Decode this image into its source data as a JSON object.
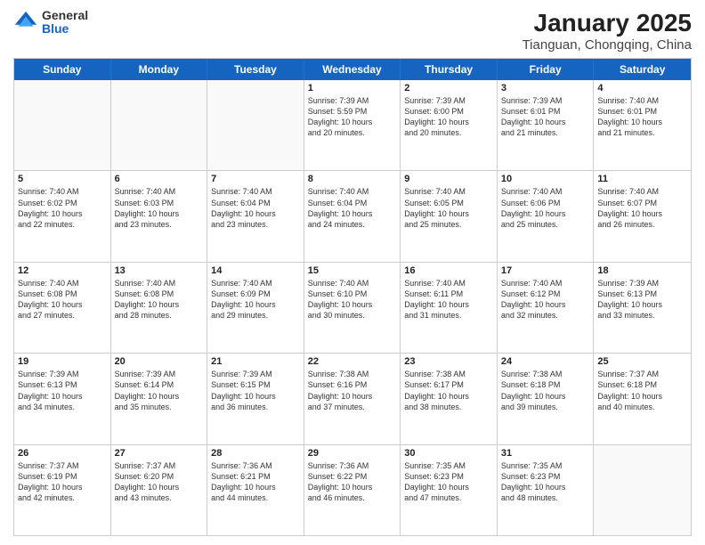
{
  "logo": {
    "general": "General",
    "blue": "Blue"
  },
  "title": "January 2025",
  "subtitle": "Tianguan, Chongqing, China",
  "dayHeaders": [
    "Sunday",
    "Monday",
    "Tuesday",
    "Wednesday",
    "Thursday",
    "Friday",
    "Saturday"
  ],
  "weeks": [
    [
      {
        "num": "",
        "info": ""
      },
      {
        "num": "",
        "info": ""
      },
      {
        "num": "",
        "info": ""
      },
      {
        "num": "1",
        "info": "Sunrise: 7:39 AM\nSunset: 5:59 PM\nDaylight: 10 hours\nand 20 minutes."
      },
      {
        "num": "2",
        "info": "Sunrise: 7:39 AM\nSunset: 6:00 PM\nDaylight: 10 hours\nand 20 minutes."
      },
      {
        "num": "3",
        "info": "Sunrise: 7:39 AM\nSunset: 6:01 PM\nDaylight: 10 hours\nand 21 minutes."
      },
      {
        "num": "4",
        "info": "Sunrise: 7:40 AM\nSunset: 6:01 PM\nDaylight: 10 hours\nand 21 minutes."
      }
    ],
    [
      {
        "num": "5",
        "info": "Sunrise: 7:40 AM\nSunset: 6:02 PM\nDaylight: 10 hours\nand 22 minutes."
      },
      {
        "num": "6",
        "info": "Sunrise: 7:40 AM\nSunset: 6:03 PM\nDaylight: 10 hours\nand 23 minutes."
      },
      {
        "num": "7",
        "info": "Sunrise: 7:40 AM\nSunset: 6:04 PM\nDaylight: 10 hours\nand 23 minutes."
      },
      {
        "num": "8",
        "info": "Sunrise: 7:40 AM\nSunset: 6:04 PM\nDaylight: 10 hours\nand 24 minutes."
      },
      {
        "num": "9",
        "info": "Sunrise: 7:40 AM\nSunset: 6:05 PM\nDaylight: 10 hours\nand 25 minutes."
      },
      {
        "num": "10",
        "info": "Sunrise: 7:40 AM\nSunset: 6:06 PM\nDaylight: 10 hours\nand 25 minutes."
      },
      {
        "num": "11",
        "info": "Sunrise: 7:40 AM\nSunset: 6:07 PM\nDaylight: 10 hours\nand 26 minutes."
      }
    ],
    [
      {
        "num": "12",
        "info": "Sunrise: 7:40 AM\nSunset: 6:08 PM\nDaylight: 10 hours\nand 27 minutes."
      },
      {
        "num": "13",
        "info": "Sunrise: 7:40 AM\nSunset: 6:08 PM\nDaylight: 10 hours\nand 28 minutes."
      },
      {
        "num": "14",
        "info": "Sunrise: 7:40 AM\nSunset: 6:09 PM\nDaylight: 10 hours\nand 29 minutes."
      },
      {
        "num": "15",
        "info": "Sunrise: 7:40 AM\nSunset: 6:10 PM\nDaylight: 10 hours\nand 30 minutes."
      },
      {
        "num": "16",
        "info": "Sunrise: 7:40 AM\nSunset: 6:11 PM\nDaylight: 10 hours\nand 31 minutes."
      },
      {
        "num": "17",
        "info": "Sunrise: 7:40 AM\nSunset: 6:12 PM\nDaylight: 10 hours\nand 32 minutes."
      },
      {
        "num": "18",
        "info": "Sunrise: 7:39 AM\nSunset: 6:13 PM\nDaylight: 10 hours\nand 33 minutes."
      }
    ],
    [
      {
        "num": "19",
        "info": "Sunrise: 7:39 AM\nSunset: 6:13 PM\nDaylight: 10 hours\nand 34 minutes."
      },
      {
        "num": "20",
        "info": "Sunrise: 7:39 AM\nSunset: 6:14 PM\nDaylight: 10 hours\nand 35 minutes."
      },
      {
        "num": "21",
        "info": "Sunrise: 7:39 AM\nSunset: 6:15 PM\nDaylight: 10 hours\nand 36 minutes."
      },
      {
        "num": "22",
        "info": "Sunrise: 7:38 AM\nSunset: 6:16 PM\nDaylight: 10 hours\nand 37 minutes."
      },
      {
        "num": "23",
        "info": "Sunrise: 7:38 AM\nSunset: 6:17 PM\nDaylight: 10 hours\nand 38 minutes."
      },
      {
        "num": "24",
        "info": "Sunrise: 7:38 AM\nSunset: 6:18 PM\nDaylight: 10 hours\nand 39 minutes."
      },
      {
        "num": "25",
        "info": "Sunrise: 7:37 AM\nSunset: 6:18 PM\nDaylight: 10 hours\nand 40 minutes."
      }
    ],
    [
      {
        "num": "26",
        "info": "Sunrise: 7:37 AM\nSunset: 6:19 PM\nDaylight: 10 hours\nand 42 minutes."
      },
      {
        "num": "27",
        "info": "Sunrise: 7:37 AM\nSunset: 6:20 PM\nDaylight: 10 hours\nand 43 minutes."
      },
      {
        "num": "28",
        "info": "Sunrise: 7:36 AM\nSunset: 6:21 PM\nDaylight: 10 hours\nand 44 minutes."
      },
      {
        "num": "29",
        "info": "Sunrise: 7:36 AM\nSunset: 6:22 PM\nDaylight: 10 hours\nand 46 minutes."
      },
      {
        "num": "30",
        "info": "Sunrise: 7:35 AM\nSunset: 6:23 PM\nDaylight: 10 hours\nand 47 minutes."
      },
      {
        "num": "31",
        "info": "Sunrise: 7:35 AM\nSunset: 6:23 PM\nDaylight: 10 hours\nand 48 minutes."
      },
      {
        "num": "",
        "info": ""
      }
    ]
  ]
}
